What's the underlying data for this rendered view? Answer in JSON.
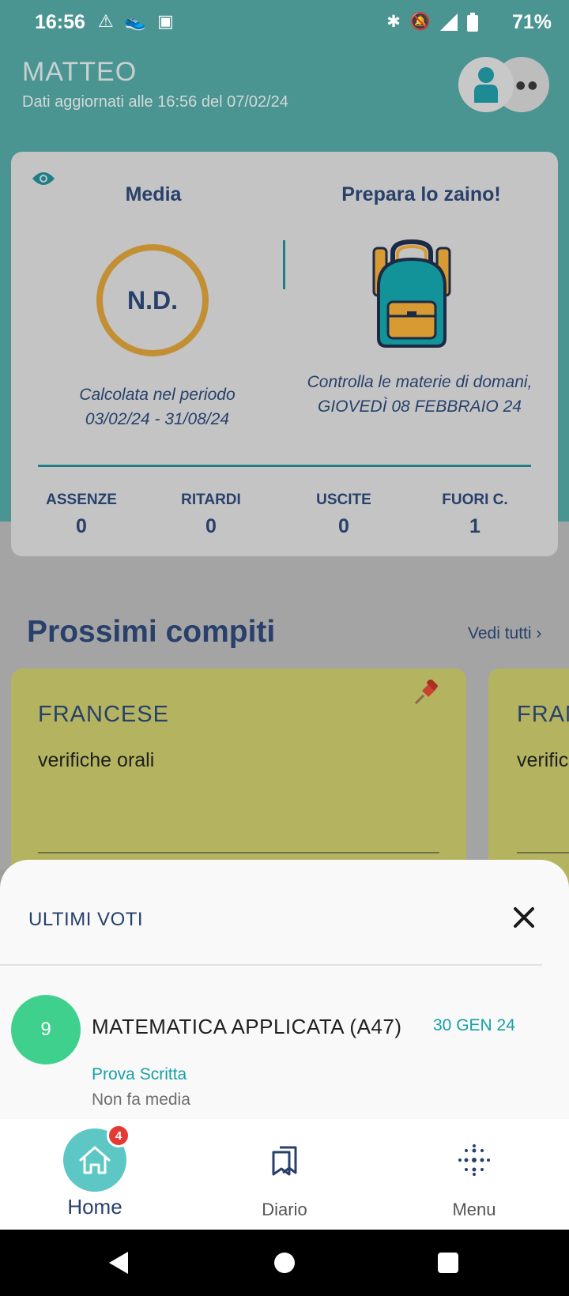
{
  "status_bar": {
    "time": "16:56",
    "battery": "71%",
    "left_icons": [
      "warning-icon",
      "shoe-icon",
      "photo-icon"
    ],
    "right_icons": [
      "bluetooth-icon",
      "mute-icon",
      "signal-4g-icon",
      "battery-icon"
    ]
  },
  "header": {
    "name": "MATTEO",
    "subtitle": "Dati aggiornati alle 16:56 del 07/02/24"
  },
  "summary": {
    "media_title": "Media",
    "media_value": "N.D.",
    "media_note_line1": "Calcolata nel periodo",
    "media_note_line2": "03/02/24 - 31/08/24",
    "zaino_title": "Prepara lo zaino!",
    "zaino_note": "Controlla le materie di domani, GIOVEDÌ 08 FEBBRAIO 24",
    "stats": [
      {
        "label": "ASSENZE",
        "value": "0"
      },
      {
        "label": "RITARDI",
        "value": "0"
      },
      {
        "label": "USCITE",
        "value": "0"
      },
      {
        "label": "FUORI C.",
        "value": "1"
      }
    ]
  },
  "homework": {
    "title": "Prossimi compiti",
    "see_all": "Vedi tutti ›",
    "cards": [
      {
        "subject": "FRANCESE",
        "description": "verifiche orali"
      },
      {
        "subject": "FRAN",
        "description": "verific"
      }
    ]
  },
  "grades_sheet": {
    "title": "ULTIMI VOTI",
    "items": [
      {
        "grade": "9",
        "subject": "MATEMATICA APPLICATA (A47)",
        "date": "30 GEN 24",
        "type": "Prova Scritta",
        "note": "Non fa media"
      }
    ]
  },
  "nav": {
    "items": [
      {
        "label": "Home",
        "icon": "home-icon",
        "badge": "4"
      },
      {
        "label": "Diario",
        "icon": "bookmarks-icon"
      },
      {
        "label": "Menu",
        "icon": "dots-grid-icon"
      }
    ]
  },
  "colors": {
    "teal": "#4a9491",
    "navy": "#28406b",
    "gold": "#c38f35",
    "card_yellow": "#b4b460",
    "grade_green": "#3fd08d",
    "accent_cyan": "#17a0a9"
  }
}
